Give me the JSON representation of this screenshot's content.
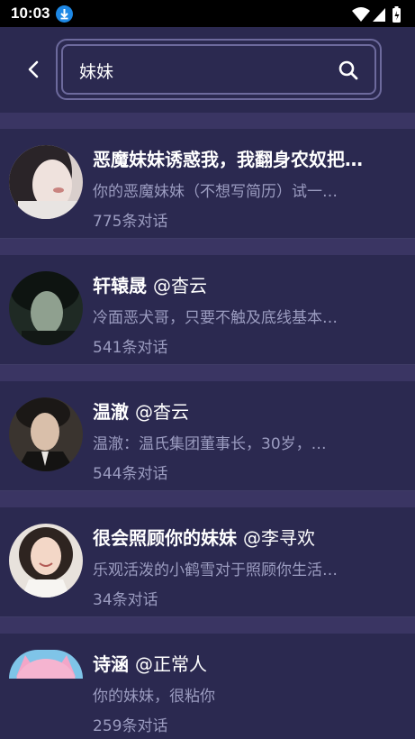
{
  "status_bar": {
    "time": "10:03"
  },
  "search": {
    "value": "妹妹"
  },
  "results": [
    {
      "title": "恶魔妹妹诱惑我，我翻身农奴把…",
      "author": "",
      "desc": "你的恶魔妹妹（不想写简历）试一…",
      "count": "775条对话",
      "avatar_icon": "girl-portrait-avatar"
    },
    {
      "title": "轩辕晟",
      "author": "@杳云",
      "desc": "冷面恶犬哥，只要不触及底线基本…",
      "count": "541条对话",
      "avatar_icon": "man-dark-portrait-avatar"
    },
    {
      "title": "温澈",
      "author": "@杳云",
      "desc": "温澈：温氏集团董事长，30岁，…",
      "count": "544条对话",
      "avatar_icon": "man-suit-portrait-avatar"
    },
    {
      "title": "很会照顾你的妹妹",
      "author": "@李寻欢",
      "desc": "乐观活泼的小鹤雪对于照顾你生活…",
      "count": "34条对话",
      "avatar_icon": "smiling-girl-avatar"
    },
    {
      "title": "诗涵",
      "author": "@正常人",
      "desc": "你的妹妹，很粘你",
      "count": "259条对话",
      "avatar_icon": "anime-girl-avatar"
    }
  ]
}
